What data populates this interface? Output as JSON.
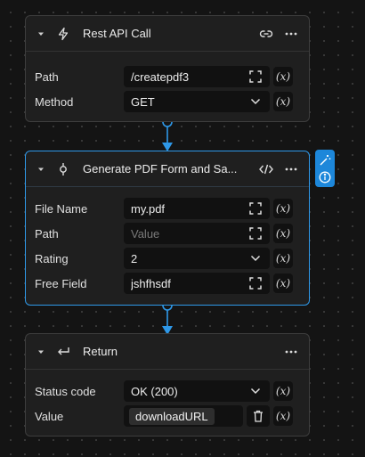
{
  "nodes": {
    "rest_api": {
      "title": "Rest API Call",
      "fields": [
        {
          "label": "Path",
          "value": "/createpdf3"
        },
        {
          "label": "Method",
          "value": "GET"
        }
      ]
    },
    "generate_pdf": {
      "title": "Generate PDF Form and Sa...",
      "fields": [
        {
          "label": "File Name",
          "value": "my.pdf"
        },
        {
          "label": "Path",
          "placeholder": "Value"
        },
        {
          "label": "Rating",
          "value": "2"
        },
        {
          "label": "Free Field",
          "value": "jshfhsdf"
        }
      ]
    },
    "return": {
      "title": "Return",
      "fields": [
        {
          "label": "Status code",
          "value": "OK (200)"
        },
        {
          "label": "Value",
          "chip": "downloadURL"
        }
      ]
    }
  },
  "variable_button_label": "(x)",
  "colors": {
    "accent": "#2e98e8",
    "node_bg": "#1f1f1f",
    "canvas_bg": "#141414"
  },
  "icons": {
    "rest_api": "bolt-icon",
    "generate_pdf": "commit-node-icon",
    "return": "return-arrow-icon",
    "side_tools": [
      "magic-wand-icon",
      "info-icon"
    ]
  }
}
